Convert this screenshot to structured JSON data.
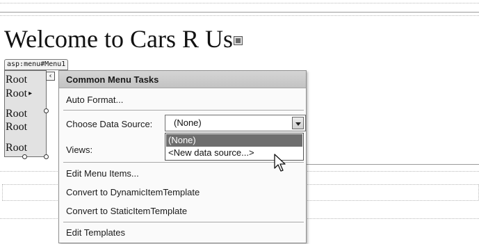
{
  "page": {
    "title": "Welcome to Cars R Us",
    "control_tag": "asp:menu#Menu1"
  },
  "menu_control": {
    "items": [
      {
        "label": "Root",
        "has_submenu": false
      },
      {
        "label": "Root",
        "has_submenu": true,
        "arrow": "▸"
      },
      {
        "label": "Root",
        "has_submenu": false
      },
      {
        "label": "Root",
        "has_submenu": false
      },
      {
        "label": "Root",
        "has_submenu": false
      }
    ],
    "collapse_glyph": "‹"
  },
  "tasks_panel": {
    "title": "Common Menu Tasks",
    "auto_format": "Auto Format...",
    "choose_data_source_label": "Choose Data Source:",
    "data_source_value": "(None)",
    "data_source_options": [
      "(None)",
      "<New data source...>"
    ],
    "selected_option_index": 0,
    "views_label": "Views:",
    "edit_menu_items": "Edit Menu Items...",
    "convert_dynamic": "Convert to DynamicItemTemplate",
    "convert_static": "Convert to StaticItemTemplate",
    "edit_templates": "Edit Templates"
  },
  "colors": {
    "panel_header": "#c9c9c9",
    "selected_option": "#6e6e6e",
    "menu_background": "#e2e2e2"
  }
}
